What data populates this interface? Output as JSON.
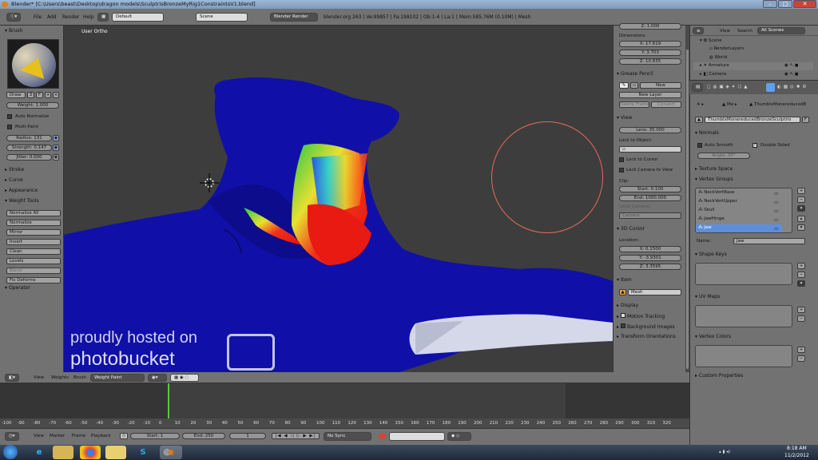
{
  "titlebar": {
    "text": "Blender* [C:\\Users\\beast\\Desktop\\dragon models\\SculptrisBronzeMyRig1ConstraintsV1.blend]"
  },
  "menubar": {
    "file": "File",
    "add": "Add",
    "render": "Render",
    "help": "Help",
    "layout": "Default",
    "scene": "Scene",
    "engine": "Blender Render",
    "stats": "blender.org 263 | Ve:99857 | Fa:198102 | Ob:1-4 | La:1 | Mem:585.76M (0.10M) | Mesh"
  },
  "toolshelf": {
    "brush_header": "Brush",
    "brush_name": "Draw",
    "brush_users": "3",
    "brush_f": "F",
    "weight": "Weight: 1.000",
    "auto_normalize": "Auto Normalize",
    "multi_paint": "Multi-Paint",
    "radius": "Radius: 131",
    "strength": "Strength: 0.147",
    "jitter": "Jitter: 0.000",
    "stroke": "Stroke",
    "curve": "Curve",
    "appearance": "Appearance",
    "weight_tools": "Weight Tools",
    "tools": [
      "Normalize All",
      "Normalize",
      "Mirror",
      "Invert",
      "Clean",
      "Levels",
      "Blend"
    ],
    "fix_deforms": "Fix Deforms",
    "operator": "Operator"
  },
  "viewport": {
    "label": "User Ortho",
    "watermark1": "proudly hosted on",
    "watermark2": "photobucket"
  },
  "npanel": {
    "z_top": "Z: 1.000",
    "dimensions": "Dimensions:",
    "dim_x": "X: 17.619",
    "dim_y": "Y: 3.703",
    "dim_z": "Z: 10.835",
    "grease_pencil": "Grease Pencil",
    "new": "New",
    "new_layer": "New Layer",
    "delete_frame": "Delete Frame",
    "convert": "Convert",
    "view": "View",
    "lens": "Lens: 35.000",
    "lock_to_object": "Lock to Object:",
    "lock_to_cursor": "Lock to Cursor",
    "lock_camera": "Lock Camera to View",
    "clip": "Clip:",
    "clip_start": "Start: 0.100",
    "clip_end": "End: 1000.000",
    "local_camera": "Local Camera:",
    "camera": "Camera",
    "cursor_3d": "3D Cursor",
    "location": "Location:",
    "loc_x": "X: 0.1500",
    "loc_y": "Y: -3.9301",
    "loc_z": "Z: 3.3595",
    "item": "Item",
    "item_name": "Mesh",
    "display": "Display",
    "motion_tracking": "Motion Tracking",
    "background_images": "Background Images",
    "transform_orientations": "Transform Orientations"
  },
  "outliner": {
    "view": "View",
    "search": "Search",
    "all_scenes": "All Scenes",
    "items": [
      "Scene",
      "RenderLayers",
      "World",
      "Armature",
      "Camera"
    ]
  },
  "props": {
    "breadcrumb_me": "Me",
    "breadcrumb_obj": "ThumblxMonereducedB",
    "mesh_name": "ThumblxMonereducedBronzeSculptris",
    "mesh_f": "F",
    "normals": "Normals",
    "auto_smooth": "Auto Smooth",
    "double_sided": "Double Sided",
    "angle": "Angle: 30°",
    "texture_space": "Texture Space",
    "vertex_groups": "Vertex Groups",
    "groups": [
      "NeckVertBase",
      "NeckVertUpper",
      "Skull",
      "JawHinge",
      "Jaw"
    ],
    "name_label": "Name:",
    "name_value": "Jaw",
    "shape_keys": "Shape Keys",
    "uv_maps": "UV Maps",
    "vertex_colors": "Vertex Colors",
    "custom_properties": "Custom Properties"
  },
  "timeline_hdr": {
    "view": "View",
    "weights": "Weights",
    "brush": "Brush",
    "mode": "Weight Paint"
  },
  "ruler": [
    "-100",
    "-90",
    "-80",
    "-70",
    "-60",
    "-50",
    "-40",
    "-30",
    "-20",
    "-10",
    "0",
    "10",
    "20",
    "30",
    "40",
    "50",
    "60",
    "70",
    "80",
    "90",
    "100",
    "110",
    "120",
    "130",
    "140",
    "150",
    "160",
    "170",
    "180",
    "190",
    "200",
    "210",
    "220",
    "230",
    "240",
    "250",
    "260",
    "270",
    "280",
    "290",
    "300",
    "310",
    "320"
  ],
  "tlfoot": {
    "view": "View",
    "marker": "Marker",
    "frame": "Frame",
    "playback": "Playback",
    "start": "Start: 1",
    "end": "End: 250",
    "current": "1",
    "sync": "No Sync"
  },
  "taskbar": {
    "time": "8:18 AM",
    "date": "11/2/2012"
  }
}
